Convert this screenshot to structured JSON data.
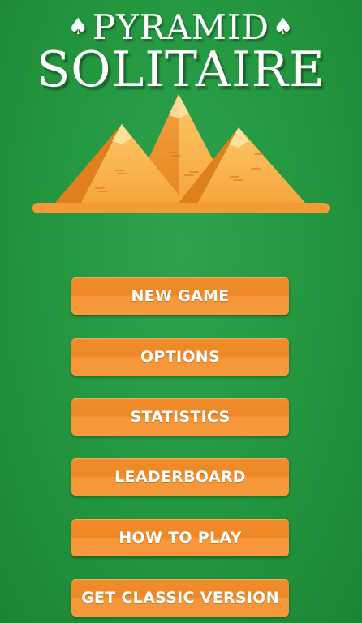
{
  "title": {
    "line1": "PYRAMID",
    "line2": "SOLITAIRE",
    "ornament": "spade-icon"
  },
  "colors": {
    "background": "#23953f",
    "button": "#f08d2b",
    "text": "#ffffff",
    "pyramid_light": "#fbc25c",
    "pyramid_dark": "#e98a22"
  },
  "menu": [
    {
      "id": "new-game",
      "label": "NEW GAME"
    },
    {
      "id": "options",
      "label": "OPTIONS"
    },
    {
      "id": "statistics",
      "label": "STATISTICS"
    },
    {
      "id": "leaderboard",
      "label": "LEADERBOARD"
    },
    {
      "id": "how-to-play",
      "label": "HOW TO PLAY"
    },
    {
      "id": "get-classic-version",
      "label": "GET CLASSIC VERSION"
    }
  ]
}
